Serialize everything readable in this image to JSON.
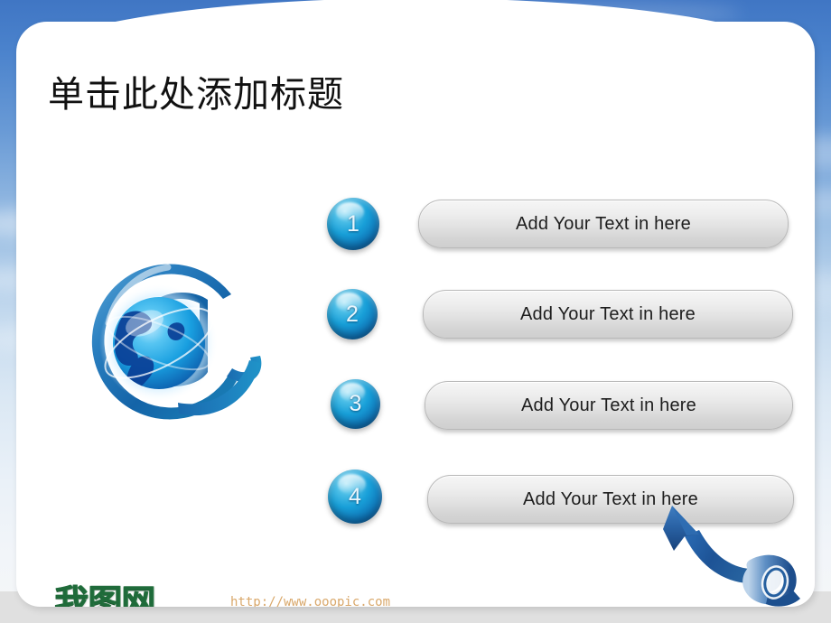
{
  "slide": {
    "title": "单击此处添加标题",
    "background_top_color": "#4a82cc",
    "background_bottom_color": "#f2f5f9",
    "panel_color": "#ffffff"
  },
  "graphic": {
    "at_symbol_name": "at-sign-globe-graphic",
    "at_symbol_color": "#1a6fb5",
    "globe_color": "#1fa5e8"
  },
  "items": [
    {
      "number": "1",
      "text": "Add Your Text in here"
    },
    {
      "number": "2",
      "text": "Add Your Text in here"
    },
    {
      "number": "3",
      "text": "Add Your Text in here"
    },
    {
      "number": "4",
      "text": "Add Your Text in here"
    }
  ],
  "decoration": {
    "arrow_name": "curved-ribbon-arrow",
    "arrow_color": "#1f5fa8"
  },
  "footer": {
    "logo_text": "我图网",
    "logo_color": "#1f6b3a",
    "url": "http://www.ooopic.com",
    "url_color": "#d9a86b"
  }
}
